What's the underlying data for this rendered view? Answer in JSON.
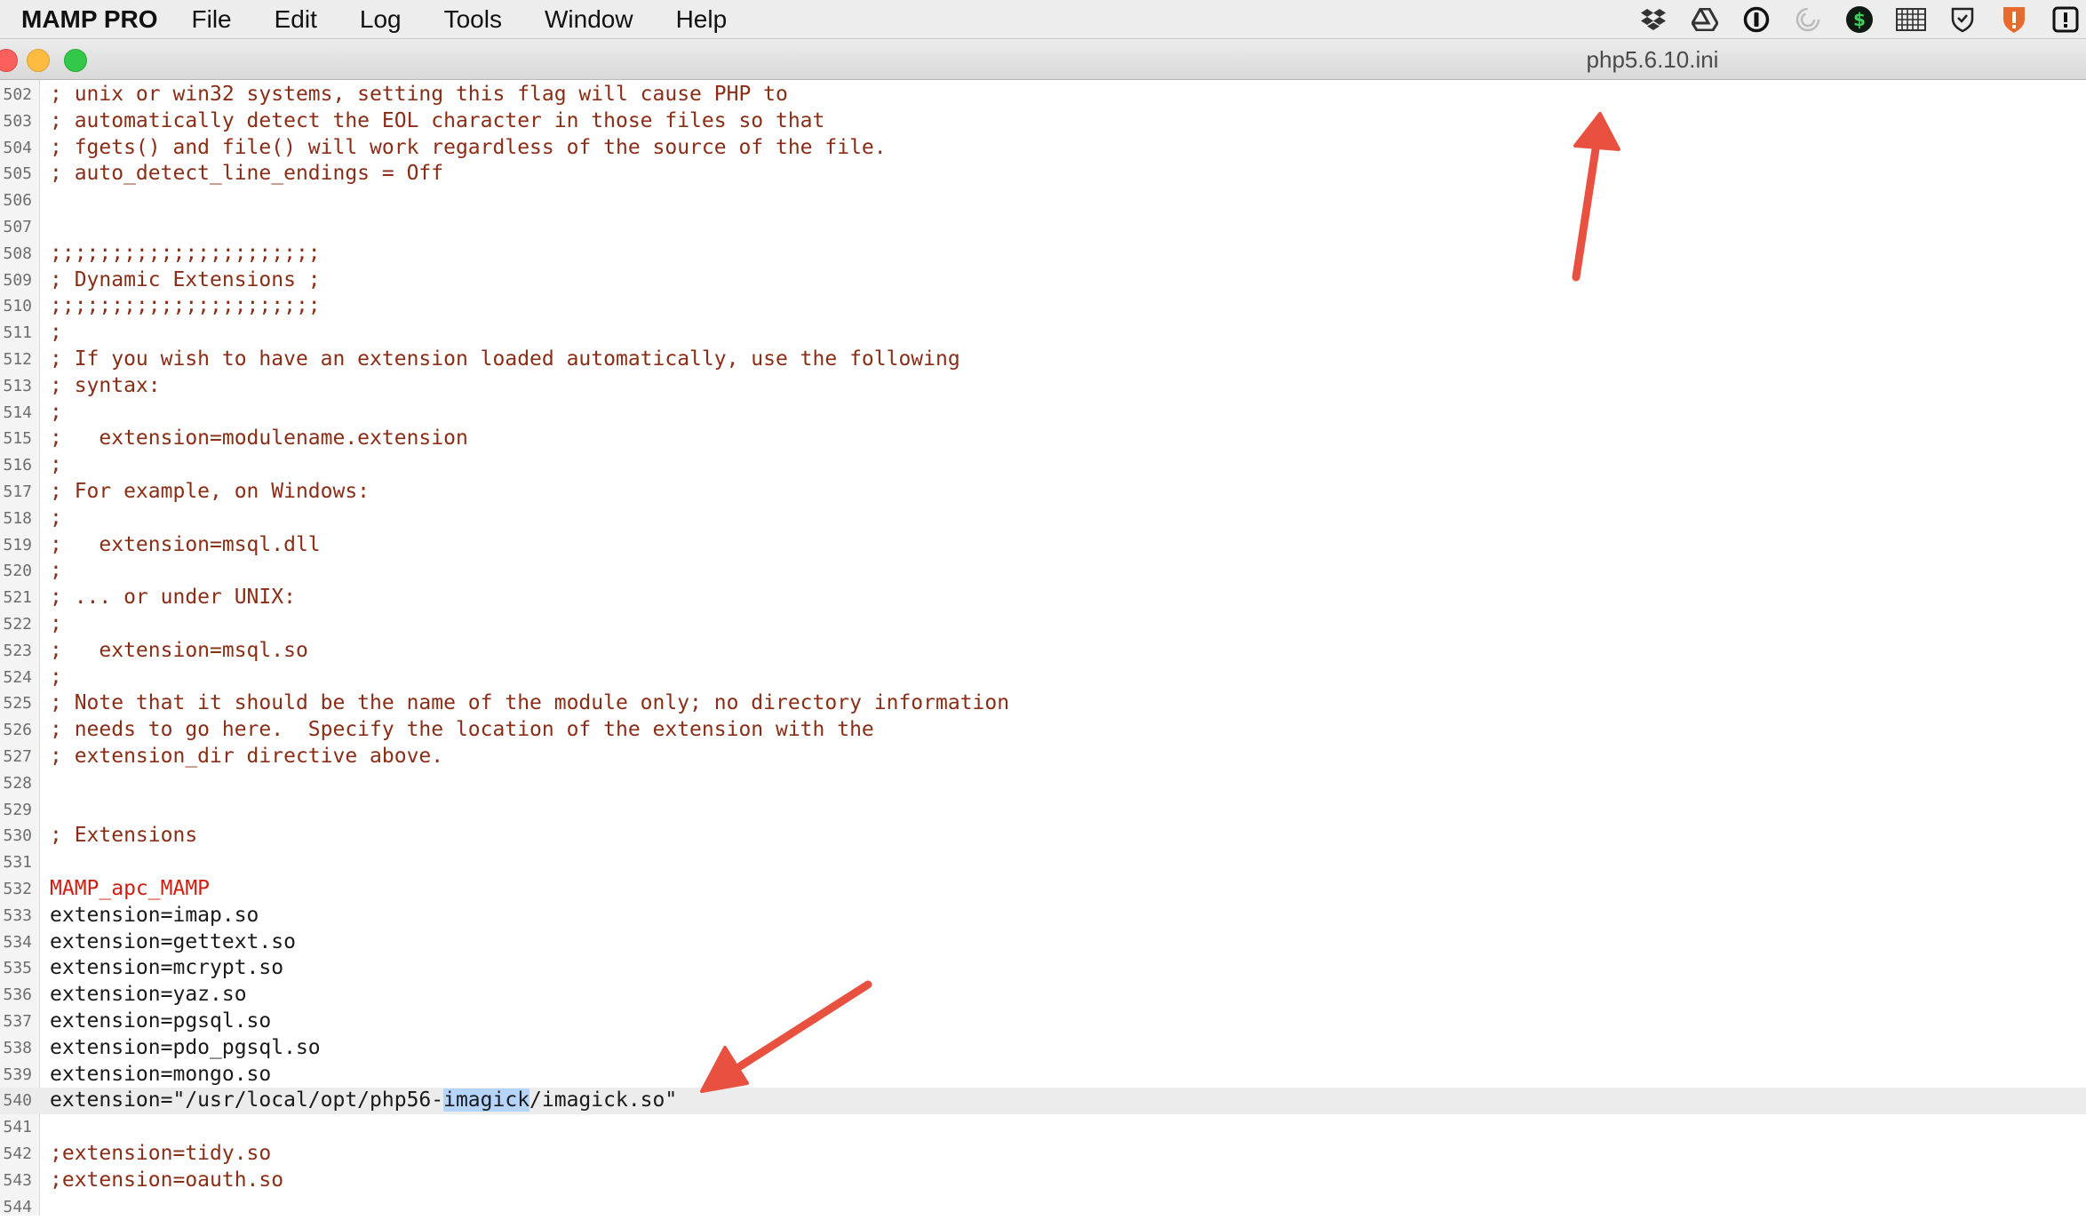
{
  "menubar": {
    "app_name": "MAMP PRO",
    "items": [
      "File",
      "Edit",
      "Log",
      "Tools",
      "Window",
      "Help"
    ],
    "tray_icons": [
      "dropbox-icon",
      "google-drive-icon",
      "onepassword-icon",
      "spinner-icon",
      "dollar-icon",
      "grid-icon",
      "shield-icon",
      "security-badge-icon",
      "alert-icon"
    ]
  },
  "window": {
    "title": "php5.6.10.ini"
  },
  "editor": {
    "current_line": "540",
    "selected_text": "imagick",
    "lines": [
      {
        "num": "502",
        "text": "; unix or win32 systems, setting this flag will cause PHP to",
        "kind": "comment"
      },
      {
        "num": "503",
        "text": "; automatically detect the EOL character in those files so that",
        "kind": "comment"
      },
      {
        "num": "504",
        "text": "; fgets() and file() will work regardless of the source of the file.",
        "kind": "comment"
      },
      {
        "num": "505",
        "text": "; auto_detect_line_endings = Off",
        "kind": "comment"
      },
      {
        "num": "506",
        "text": "",
        "kind": "comment"
      },
      {
        "num": "507",
        "text": "",
        "kind": "comment"
      },
      {
        "num": "508",
        "text": ";;;;;;;;;;;;;;;;;;;;;;",
        "kind": "comment"
      },
      {
        "num": "509",
        "text": "; Dynamic Extensions ;",
        "kind": "comment"
      },
      {
        "num": "510",
        "text": ";;;;;;;;;;;;;;;;;;;;;;",
        "kind": "comment"
      },
      {
        "num": "511",
        "text": ";",
        "kind": "comment"
      },
      {
        "num": "512",
        "text": "; If you wish to have an extension loaded automatically, use the following",
        "kind": "comment"
      },
      {
        "num": "513",
        "text": "; syntax:",
        "kind": "comment"
      },
      {
        "num": "514",
        "text": ";",
        "kind": "comment"
      },
      {
        "num": "515",
        "text": ";   extension=modulename.extension",
        "kind": "comment"
      },
      {
        "num": "516",
        "text": ";",
        "kind": "comment"
      },
      {
        "num": "517",
        "text": "; For example, on Windows:",
        "kind": "comment"
      },
      {
        "num": "518",
        "text": ";",
        "kind": "comment"
      },
      {
        "num": "519",
        "text": ";   extension=msql.dll",
        "kind": "comment"
      },
      {
        "num": "520",
        "text": ";",
        "kind": "comment"
      },
      {
        "num": "521",
        "text": "; ... or under UNIX:",
        "kind": "comment"
      },
      {
        "num": "522",
        "text": ";",
        "kind": "comment"
      },
      {
        "num": "523",
        "text": ";   extension=msql.so",
        "kind": "comment"
      },
      {
        "num": "524",
        "text": ";",
        "kind": "comment"
      },
      {
        "num": "525",
        "text": "; Note that it should be the name of the module only; no directory information",
        "kind": "comment"
      },
      {
        "num": "526",
        "text": "; needs to go here.  Specify the location of the extension with the",
        "kind": "comment"
      },
      {
        "num": "527",
        "text": "; extension_dir directive above.",
        "kind": "comment"
      },
      {
        "num": "528",
        "text": "",
        "kind": "comment"
      },
      {
        "num": "529",
        "text": "",
        "kind": "comment"
      },
      {
        "num": "530",
        "text": "; Extensions",
        "kind": "comment"
      },
      {
        "num": "531",
        "text": "",
        "kind": "comment"
      },
      {
        "num": "532",
        "text": "MAMP_apc_MAMP",
        "kind": "marker"
      },
      {
        "num": "533",
        "text": "extension=imap.so",
        "kind": "directive"
      },
      {
        "num": "534",
        "text": "extension=gettext.so",
        "kind": "directive"
      },
      {
        "num": "535",
        "text": "extension=mcrypt.so",
        "kind": "directive"
      },
      {
        "num": "536",
        "text": "extension=yaz.so",
        "kind": "directive"
      },
      {
        "num": "537",
        "text": "extension=pgsql.so",
        "kind": "directive"
      },
      {
        "num": "538",
        "text": "extension=pdo_pgsql.so",
        "kind": "directive"
      },
      {
        "num": "539",
        "text": "extension=mongo.so",
        "kind": "directive"
      },
      {
        "num": "540",
        "text": "extension=\"/usr/local/opt/php56-imagick/imagick.so\"",
        "kind": "directive"
      },
      {
        "num": "541",
        "text": "",
        "kind": "comment"
      },
      {
        "num": "542",
        "text": ";extension=tidy.so",
        "kind": "comment"
      },
      {
        "num": "543",
        "text": ";extension=oauth.so",
        "kind": "comment"
      },
      {
        "num": "544",
        "text": "",
        "kind": "comment"
      }
    ]
  },
  "colors": {
    "comment": "#8a2d16",
    "directive": "#1a1a1a",
    "marker": "#cf1f12",
    "selection": "#b5d5ff",
    "arrow": "#e8513f"
  }
}
